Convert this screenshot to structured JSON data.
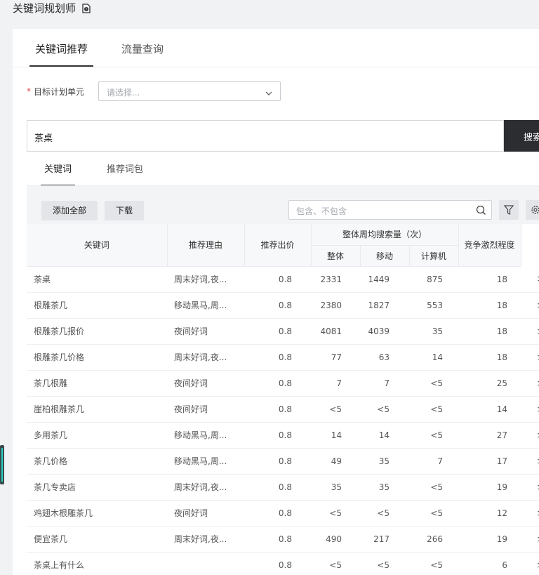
{
  "page": {
    "title": "关键词规划师"
  },
  "top_tabs": [
    {
      "label": "关键词推荐",
      "active": true
    },
    {
      "label": "流量查询",
      "active": false
    }
  ],
  "target_unit": {
    "required_mark": "*",
    "label": "目标计划单元",
    "placeholder": "请选择..."
  },
  "search": {
    "value": "茶桌",
    "button_label": "搜索"
  },
  "sub_tabs": [
    {
      "label": "关键词",
      "active": true
    },
    {
      "label": "推荐词包",
      "active": false
    }
  ],
  "toolbar": {
    "add_all_label": "添加全部",
    "download_label": "下载",
    "filter_placeholder": "包含、不包含"
  },
  "table": {
    "headers": {
      "keyword": "关键词",
      "reason": "推荐理由",
      "bid": "推荐出价",
      "weekly_search": "整体周均搜索量（次）",
      "overall": "整体",
      "mobile": "移动",
      "pc": "计算机",
      "competition": "竞争激烈程度"
    },
    "row_action": ">",
    "rows": [
      {
        "keyword": "茶桌",
        "reason": "周末好词,夜...",
        "bid": "0.8",
        "overall": "2331",
        "mobile": "1449",
        "pc": "875",
        "competition": "18"
      },
      {
        "keyword": "根雕茶几",
        "reason": "移动黑马,周...",
        "bid": "0.8",
        "overall": "2380",
        "mobile": "1827",
        "pc": "553",
        "competition": "18"
      },
      {
        "keyword": "根雕茶几报价",
        "reason": "夜间好词",
        "bid": "0.8",
        "overall": "4081",
        "mobile": "4039",
        "pc": "35",
        "competition": "18"
      },
      {
        "keyword": "根雕茶几价格",
        "reason": "周末好词,夜...",
        "bid": "0.8",
        "overall": "77",
        "mobile": "63",
        "pc": "14",
        "competition": "18"
      },
      {
        "keyword": "茶几根雕",
        "reason": "夜间好词",
        "bid": "0.8",
        "overall": "7",
        "mobile": "7",
        "pc": "<5",
        "competition": "25"
      },
      {
        "keyword": "崖柏根雕茶几",
        "reason": "夜间好词",
        "bid": "0.8",
        "overall": "<5",
        "mobile": "<5",
        "pc": "<5",
        "competition": "14"
      },
      {
        "keyword": "多用茶几",
        "reason": "移动黑马,周...",
        "bid": "0.8",
        "overall": "14",
        "mobile": "14",
        "pc": "<5",
        "competition": "27"
      },
      {
        "keyword": "茶几价格",
        "reason": "移动黑马,周...",
        "bid": "0.8",
        "overall": "49",
        "mobile": "35",
        "pc": "7",
        "competition": "17"
      },
      {
        "keyword": "茶几专卖店",
        "reason": "周末好词,夜...",
        "bid": "0.8",
        "overall": "35",
        "mobile": "35",
        "pc": "<5",
        "competition": "19"
      },
      {
        "keyword": "鸡翅木根雕茶几",
        "reason": "夜间好词",
        "bid": "0.8",
        "overall": "<5",
        "mobile": "<5",
        "pc": "<5",
        "competition": "12"
      },
      {
        "keyword": "便宜茶几",
        "reason": "周末好词,夜...",
        "bid": "0.8",
        "overall": "490",
        "mobile": "217",
        "pc": "266",
        "competition": "19"
      },
      {
        "keyword": "茶桌上有什么",
        "reason": "",
        "bid": "0.8",
        "overall": "<5",
        "mobile": "<5",
        "pc": "<5",
        "competition": "6"
      }
    ]
  },
  "icons": {
    "title_help": "doc-help-icon",
    "select_chevron": "chevron-down-icon",
    "filter_search": "search-icon",
    "funnel": "filter-icon",
    "gear": "gear-icon"
  }
}
